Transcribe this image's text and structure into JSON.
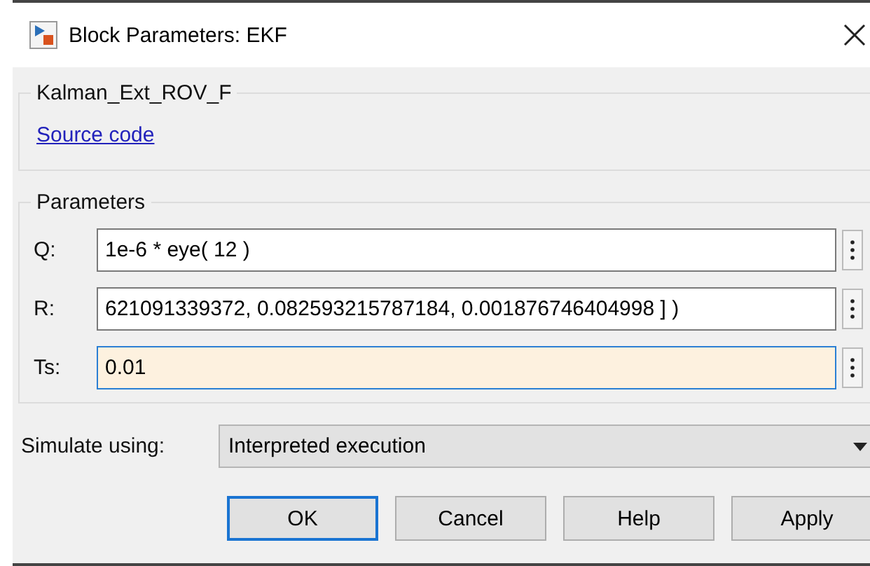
{
  "window": {
    "title": "Block Parameters: EKF"
  },
  "block_group": {
    "title": "Kalman_Ext_ROV_F",
    "link": "Source code"
  },
  "parameters": {
    "title": "Parameters",
    "fields": [
      {
        "label": "Q:",
        "value": "1e-6 * eye( 12 )",
        "focused": false
      },
      {
        "label": "R:",
        "value": "621091339372, 0.082593215787184, 0.001876746404998 ] )",
        "focused": false
      },
      {
        "label": "Ts:",
        "value": "0.01",
        "focused": true
      }
    ]
  },
  "simulate": {
    "label": "Simulate using:",
    "value": "Interpreted execution"
  },
  "buttons": [
    {
      "label": "OK",
      "default": true
    },
    {
      "label": "Cancel",
      "default": false
    },
    {
      "label": "Help",
      "default": false
    },
    {
      "label": "Apply",
      "default": false
    }
  ]
}
